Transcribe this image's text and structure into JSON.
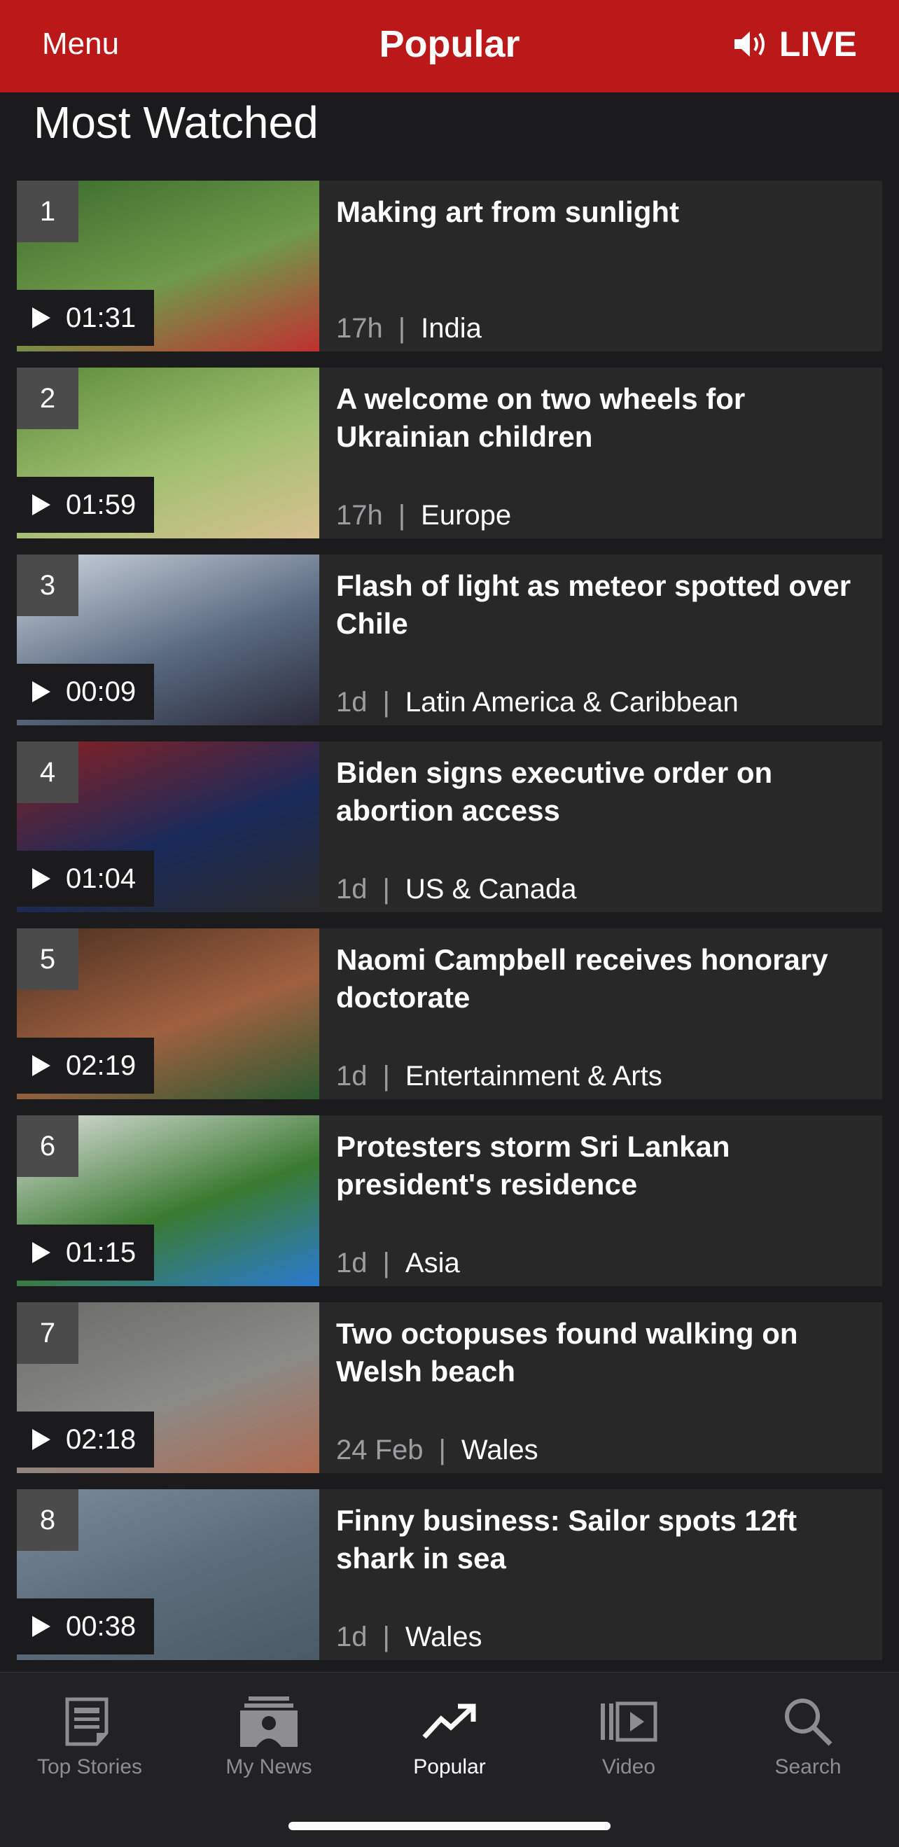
{
  "header": {
    "menu_label": "Menu",
    "title": "Popular",
    "live_label": "LIVE"
  },
  "section_title": "Most Watched",
  "items": [
    {
      "rank": "1",
      "duration": "01:31",
      "title": "Making art from sunlight",
      "time": "17h",
      "category": "India",
      "thumb": [
        "#3b6b2d",
        "#6f9a4a",
        "#c03030"
      ]
    },
    {
      "rank": "2",
      "duration": "01:59",
      "title": "A welcome on two wheels for Ukrainian children",
      "time": "17h",
      "category": "Europe",
      "thumb": [
        "#5b8a3a",
        "#a0c070",
        "#d8c090"
      ]
    },
    {
      "rank": "3",
      "duration": "00:09",
      "title": "Flash of light as meteor spotted over Chile",
      "time": "1d",
      "category": "Latin America & Caribbean",
      "thumb": [
        "#cfd6e0",
        "#5a6a80",
        "#2a2a3a"
      ]
    },
    {
      "rank": "4",
      "duration": "01:04",
      "title": "Biden signs executive order on abortion access",
      "time": "1d",
      "category": "US & Canada",
      "thumb": [
        "#8a2020",
        "#1a2a5a",
        "#2a2a2a"
      ]
    },
    {
      "rank": "5",
      "duration": "02:19",
      "title": "Naomi Campbell receives honorary doctorate",
      "time": "1d",
      "category": "Entertainment & Arts",
      "thumb": [
        "#4a3020",
        "#a06040",
        "#2a5a30"
      ]
    },
    {
      "rank": "6",
      "duration": "01:15",
      "title": "Protesters storm Sri Lankan president's residence",
      "time": "1d",
      "category": "Asia",
      "thumb": [
        "#e0e0e0",
        "#3a7a30",
        "#2a7ad0"
      ]
    },
    {
      "rank": "7",
      "duration": "02:18",
      "title": "Two octopuses found walking on Welsh beach",
      "time": "24 Feb",
      "category": "Wales",
      "thumb": [
        "#6a6a68",
        "#8a8a86",
        "#b06a50"
      ]
    },
    {
      "rank": "8",
      "duration": "00:38",
      "title": "Finny business: Sailor spots 12ft shark in sea",
      "time": "1d",
      "category": "Wales",
      "thumb": [
        "#7a8a9a",
        "#5a6a78",
        "#4a5a66"
      ]
    }
  ],
  "tabs": [
    {
      "label": "Top Stories",
      "icon": "newspaper-icon"
    },
    {
      "label": "My News",
      "icon": "my-news-icon"
    },
    {
      "label": "Popular",
      "icon": "trending-icon"
    },
    {
      "label": "Video",
      "icon": "video-icon"
    },
    {
      "label": "Search",
      "icon": "search-icon"
    }
  ],
  "colors": {
    "brand": "#bb1919",
    "background": "#1b1b1d",
    "card": "#282829",
    "muted": "#9d9d9f"
  }
}
